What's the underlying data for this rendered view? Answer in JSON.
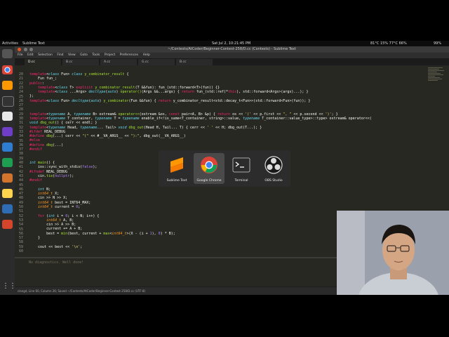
{
  "topbar": {
    "activities": "Activities",
    "app_name": "Sublime Text",
    "clock": "Sat Jul 2, 10:21:45 PM",
    "weather": "81°C 15% 77°C 66%",
    "battery": "99%"
  },
  "window": {
    "title": "~/Contests/AtCoder/Beginner-Contest-258/D.cc (Contests) - Sublime Text"
  },
  "menu": [
    "File",
    "Edit",
    "Selection",
    "Find",
    "View",
    "Goto",
    "Tools",
    "Project",
    "Preferences",
    "Help"
  ],
  "tabs": [
    {
      "label": "D.cc",
      "active": true
    },
    {
      "label": "B.cc",
      "active": false
    },
    {
      "label": "A.cc",
      "active": false
    },
    {
      "label": "G.cc",
      "active": false
    },
    {
      "label": "B.cc",
      "active": false
    }
  ],
  "editor": {
    "line_numbers": [
      "20",
      "21",
      "22",
      "23",
      "24",
      "25",
      "26",
      "27",
      "28",
      "29",
      "30",
      "31",
      "32",
      "33",
      "34",
      "35",
      "36",
      "37",
      "38",
      "39",
      "40",
      "41",
      "42",
      "43",
      "44",
      "45",
      "46",
      "47",
      "48",
      "49",
      "50",
      "51",
      "52",
      "53",
      "54",
      "55",
      "56",
      "57",
      "58",
      "59",
      "60"
    ],
    "console_message": "No diagnostics. Well done!"
  },
  "statusbar": {
    "text": "clangd, Line 60, Column 26; Saved ~/Contests/AtCoder/Beginner-Contest-258/D.cc (UTF-8)"
  },
  "switcher": {
    "items": [
      {
        "label": "Sublime Text",
        "selected": false
      },
      {
        "label": "Google Chrome",
        "selected": true
      },
      {
        "label": "Terminal",
        "selected": false
      },
      {
        "label": "OBS Studio",
        "selected": false
      }
    ]
  },
  "colors": {
    "editor_bg": "#272822",
    "keyword": "#f92672",
    "type": "#66d9ef",
    "function": "#a6e22e",
    "number": "#ae81ff",
    "string": "#e6db74",
    "comment": "#75715e"
  }
}
